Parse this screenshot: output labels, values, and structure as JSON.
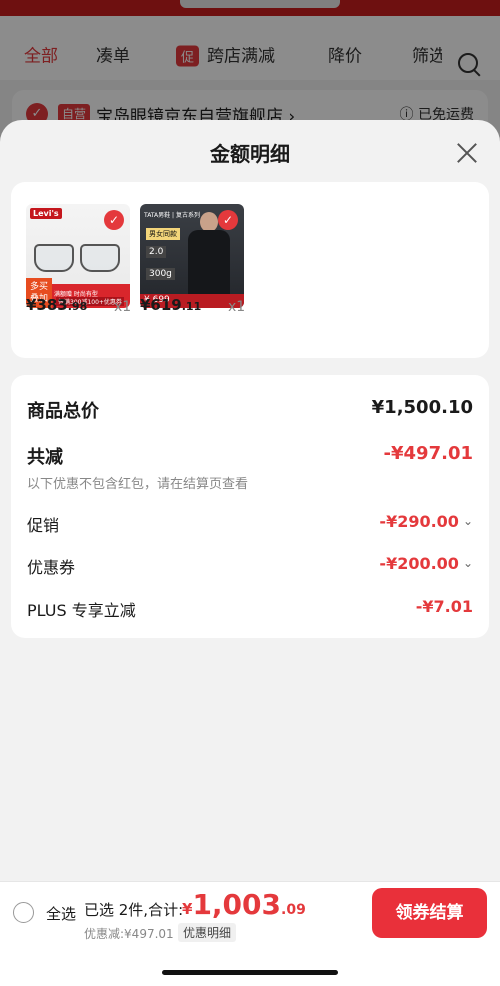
{
  "background": {
    "tabs": [
      {
        "label": "全部",
        "active": true
      },
      {
        "label": "凑单",
        "active": false
      },
      {
        "label": "跨店满减",
        "tag": "促",
        "active": false
      },
      {
        "label": "降价",
        "active": false
      },
      {
        "label": "筛选",
        "active": false
      }
    ],
    "store": {
      "tag": "自营",
      "name": "宝岛眼镜京东自营旗舰店 ›",
      "shipping": "ⓘ 已免运费"
    }
  },
  "sheet": {
    "title": "金额明细",
    "products": [
      {
        "price_int": "¥383",
        "price_dec": ".98",
        "qty": "x1",
        "brand": "Levi's",
        "ribbon": "多买叠加",
        "promo": "满额赠 时尚有型",
        "promo2": "每满300减100+优惠券"
      },
      {
        "price_int": "¥619",
        "price_dec": ".11",
        "qty": "x1",
        "brand": "TATA男鞋 | 复古系列",
        "badge_a": "男女同款",
        "badge_b": "2.0",
        "badge_c": "300g",
        "strip_price": "¥ 699"
      }
    ],
    "rows": {
      "total_label": "商品总价",
      "total_value": "¥1,500.10",
      "reduce_label": "共减",
      "reduce_value": "-¥497.01",
      "note": "以下优惠不包含红包，请在结算页查看",
      "promo_label": "促销",
      "promo_value": "-¥290.00",
      "coupon_label": "优惠券",
      "coupon_value": "-¥200.00",
      "plus_label": "PLUS 专享立减",
      "plus_value": "-¥7.01"
    }
  },
  "bottom": {
    "select_all": "全选",
    "summary": "已选 2件,合计:",
    "total_cur": "¥",
    "total_int": "1,003",
    "total_dec": ".09",
    "discount": "优惠减:¥497.01",
    "detail_label": "优惠明细",
    "checkout_label": "领券结算"
  },
  "colors": {
    "accent": "#e4393c",
    "checkout": "#e9303a"
  }
}
